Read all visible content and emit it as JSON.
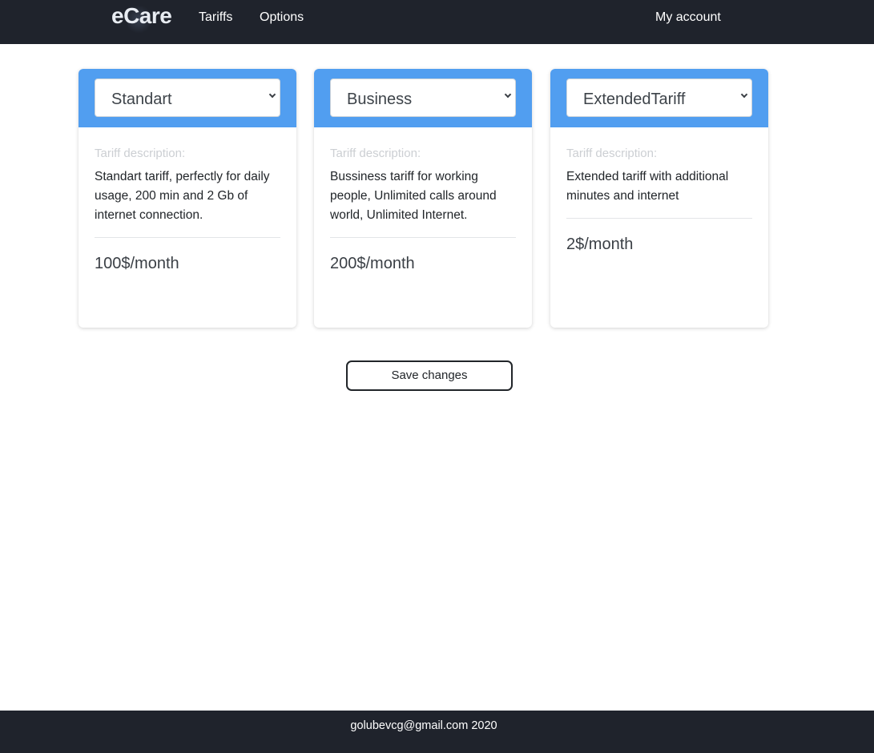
{
  "navbar": {
    "logo": "eCare",
    "links": [
      {
        "label": "Tariffs"
      },
      {
        "label": "Options"
      }
    ],
    "account_label": "My account"
  },
  "tariffs": [
    {
      "selected": "Standart",
      "description_label": "Tariff description:",
      "description": "Standart tariff, perfectly for daily usage, 200 min and 2 Gb of internet connection.",
      "price": "100$/month"
    },
    {
      "selected": "Business",
      "description_label": "Tariff description:",
      "description": "Bussiness tariff for working people, Unlimited calls around world, Unlimited Internet.",
      "price": "200$/month"
    },
    {
      "selected": "ExtendedTariff",
      "description_label": "Tariff description:",
      "description": "Extended tariff with additional minutes and internet",
      "price": "2$/month"
    }
  ],
  "actions": {
    "save_label": "Save changes"
  },
  "footer": {
    "text": "golubevcg@gmail.com 2020"
  },
  "colors": {
    "navbar_bg": "#1f232c",
    "card_header": "#519ef0"
  },
  "icons": {
    "select_arrow": "chevron-down-icon"
  }
}
